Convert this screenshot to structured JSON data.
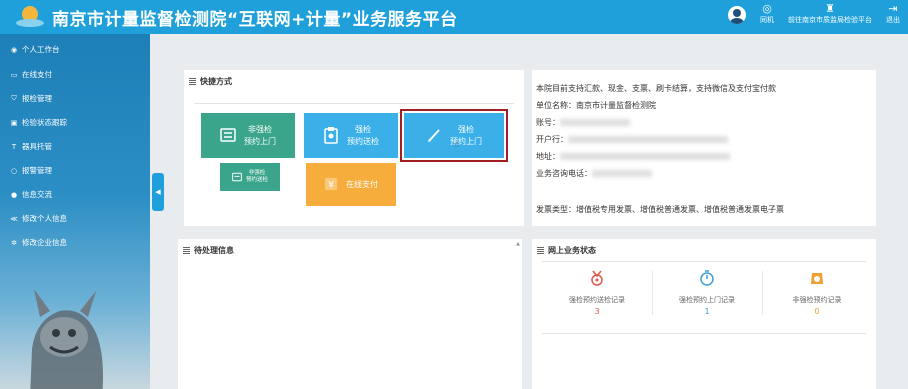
{
  "header": {
    "title": "南京市计量监督检测院“互联网+计量”业务服务平台",
    "actions": [
      {
        "label": "同机",
        "icon": "chat-icon"
      },
      {
        "label": "前往南京市质监局检验平台",
        "icon": "graduation-cap-icon"
      },
      {
        "label": "退出",
        "icon": "logout-icon"
      }
    ]
  },
  "sidebar": {
    "items": [
      {
        "label": "个人工作台",
        "icon": "dashboard-icon"
      },
      {
        "label": "在线支付",
        "icon": "card-icon"
      },
      {
        "label": "报检管理",
        "icon": "shield-icon"
      },
      {
        "label": "检验状态跟踪",
        "icon": "car-icon"
      },
      {
        "label": "器具托管",
        "icon": "tool-icon"
      },
      {
        "label": "报警管理",
        "icon": "bell-icon"
      },
      {
        "label": "信息交流",
        "icon": "chat-icon"
      },
      {
        "label": "修改个人信息",
        "icon": "user-edit-icon"
      },
      {
        "label": "修改企业信息",
        "icon": "gear-icon"
      }
    ]
  },
  "shortcuts": {
    "title": "快捷方式",
    "tiles": [
      {
        "line1": "非强检",
        "line2": "预约上门",
        "color": "#3aa58a"
      },
      {
        "line1": "强检",
        "line2": "预约送检",
        "color": "#3bb0e8"
      },
      {
        "line1": "强检",
        "line2": "预约上门",
        "color": "#3bb0e8"
      },
      {
        "line1": "非强检",
        "line2": "预约送检",
        "color": "#3aa58a"
      },
      {
        "line1": "在线支付",
        "line2": "",
        "color": "#f7ad3c"
      }
    ]
  },
  "payment_info": {
    "intro": "本院目前支持汇款、现金、支票、刷卡结算，支持微信及支付宝付款",
    "unit_label": "单位名称：",
    "unit_value": "南京市计量监督检测院",
    "account_label": "账号：",
    "bank_label": "开户行：",
    "address_label": "地址：",
    "phone_label": "业务咨询电话：",
    "invoice": "发票类型：增值税专用发票、增值税普通发票、增值税普通发票电子票"
  },
  "pending": {
    "title": "待处理信息"
  },
  "online_status": {
    "title": "网上业务状态",
    "stats": [
      {
        "label": "强检预约送检记录",
        "value": "3",
        "color": "#e05a4b",
        "icon": "medal-icon"
      },
      {
        "label": "强检预约上门记录",
        "value": "1",
        "color": "#3aa0d8",
        "icon": "stopwatch-icon"
      },
      {
        "label": "非强检预约记录",
        "value": "0",
        "color": "#f0a030",
        "icon": "scale-icon"
      }
    ]
  }
}
